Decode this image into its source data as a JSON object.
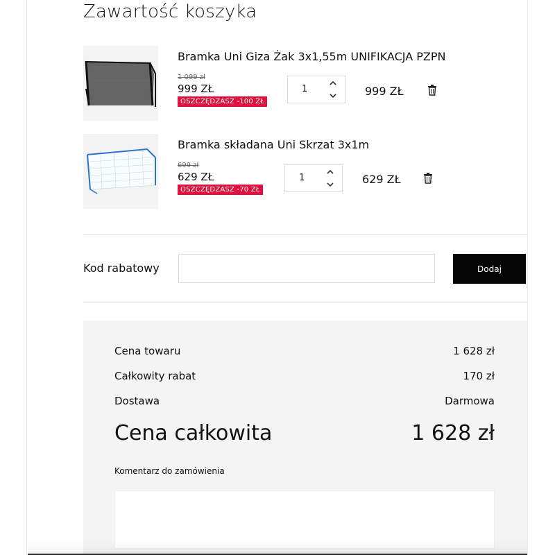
{
  "cart": {
    "title": "Zawartość koszyka",
    "items": [
      {
        "name": "Bramka Uni Giza Żak 3x1,55m UNIFIKACJA PZPN",
        "old_price": "1 099 zł",
        "price": "999 ZŁ",
        "savings": "OSZCZĘDZASZ -100 ZŁ",
        "quantity": "1",
        "line_total": "999 ZŁ",
        "image_icon": "goal-frame-black-icon"
      },
      {
        "name": "Bramka składana Uni Skrzat 3x1m",
        "old_price": "699 zł",
        "price": "629 ZŁ",
        "savings": "OSZCZĘDZASZ -70 ZŁ",
        "quantity": "1",
        "line_total": "629 ZŁ",
        "image_icon": "goal-frame-white-icon"
      }
    ]
  },
  "promo": {
    "label": "Kod rabatowy",
    "input_value": "",
    "button_label": "Dodaj"
  },
  "summary": {
    "subtotal_label": "Cena towaru",
    "subtotal_value": "1 628 zł",
    "discount_label": "Całkowity rabat",
    "discount_value": "170 zł",
    "shipping_label": "Dostawa",
    "shipping_value": "Darmowa",
    "total_label": "Cena całkowita",
    "total_value": "1 628 zł",
    "comment_label": "Komentarz do zamówienia",
    "comment_value": ""
  },
  "colors": {
    "savings_badge": "#e0113e",
    "button_bg": "#050505",
    "summary_bg": "#f4f4f4"
  }
}
